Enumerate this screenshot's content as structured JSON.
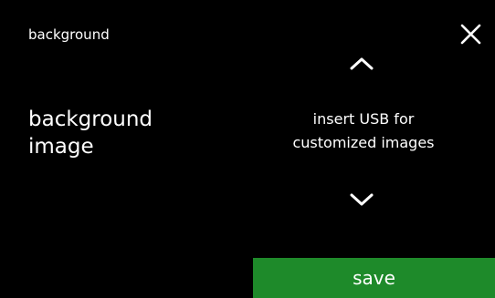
{
  "header": {
    "title": "background",
    "close_icon": "close-icon"
  },
  "setting": {
    "label_line1": "background",
    "label_line2": "image"
  },
  "selector": {
    "up_icon": "chevron-up-icon",
    "down_icon": "chevron-down-icon",
    "value_line1": "insert USB for",
    "value_line2": "customized images"
  },
  "footer": {
    "save_label": "save"
  },
  "colors": {
    "background": "#000000",
    "text": "#ffffff",
    "save_button": "#1e8a2a"
  }
}
